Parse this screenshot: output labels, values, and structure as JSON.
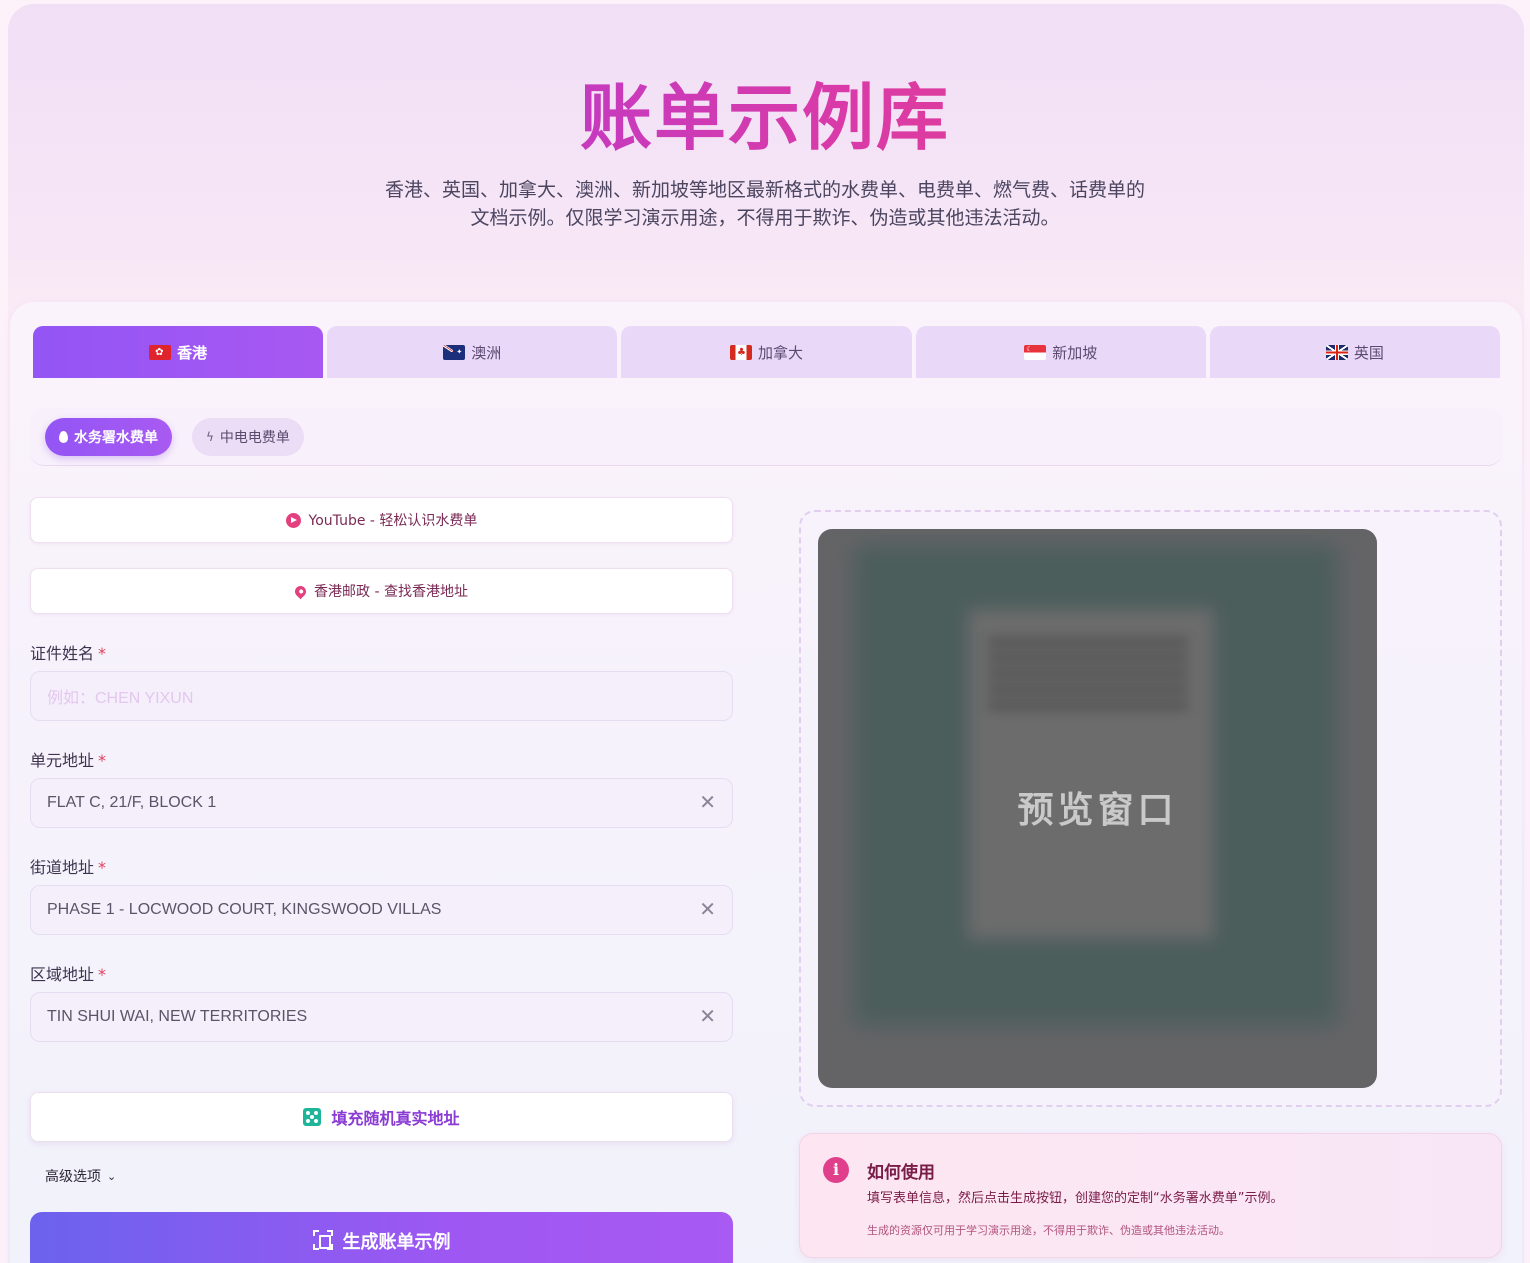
{
  "hero": {
    "title": "账单示例库",
    "subtitle": "香港、英国、加拿大、澳洲、新加坡等地区最新格式的水费单、电费单、燃气费、话费单的文档示例。仅限学习演示用途，不得用于欺诈、伪造或其他违法活动。"
  },
  "tabs": [
    {
      "label": "香港",
      "flag": "hk-flag-icon",
      "active": true
    },
    {
      "label": "澳洲",
      "flag": "au-flag-icon",
      "active": false
    },
    {
      "label": "加拿大",
      "flag": "ca-flag-icon",
      "active": false
    },
    {
      "label": "新加坡",
      "flag": "sg-flag-icon",
      "active": false
    },
    {
      "label": "英国",
      "flag": "uk-flag-icon",
      "active": false
    }
  ],
  "subtabs": [
    {
      "label": "水务署水费单",
      "icon": "water-drop-icon",
      "active": true
    },
    {
      "label": "中电电费单",
      "icon": "lightning-icon",
      "active": false
    }
  ],
  "links": {
    "youtube": "YouTube - 轻松认识水费单",
    "hongkong_post": "香港邮政 - 查找香港地址"
  },
  "form": {
    "name": {
      "label": "证件姓名",
      "required": "*",
      "value": "",
      "placeholder": "例如：CHEN YIXUN"
    },
    "unit_address": {
      "label": "单元地址",
      "required": "*",
      "value": "FLAT C, 21/F, BLOCK 1"
    },
    "street_address": {
      "label": "街道地址",
      "required": "*",
      "value": "PHASE 1 - LOCWOOD COURT, KINGSWOOD VILLAS"
    },
    "district_address": {
      "label": "区域地址",
      "required": "*",
      "value": "TIN SHUI WAI, NEW TERRITORIES"
    },
    "clear_symbol": "✕"
  },
  "buttons": {
    "random_fill": "填充随机真实地址",
    "advanced": "高级选项",
    "generate": "生成账单示例"
  },
  "preview": {
    "label": "预览窗口"
  },
  "howto": {
    "title": "如何使用",
    "text": "填写表单信息，然后点击生成按钮，创建您的定制“水务署水费单”示例。",
    "note": "生成的资源仅可用于学习演示用途，不得用于欺诈、伪造或其他违法活动。"
  },
  "colors": {
    "accent": "#9355f5",
    "title_gradient_start": "#9b3cf0",
    "title_gradient_end": "#f2456e",
    "link_text": "#7a2a55",
    "info": "#e0408b"
  }
}
